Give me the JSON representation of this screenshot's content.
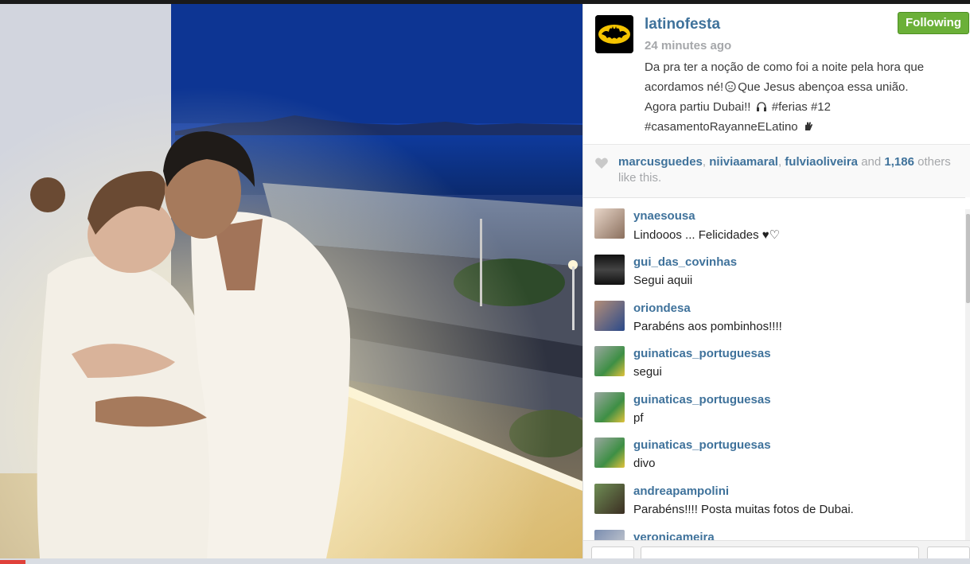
{
  "post": {
    "username": "latinofesta",
    "time_ago": "24 minutes ago",
    "follow_label": "Following",
    "caption_lines": [
      "Da pra ter a noção de como foi a noite pela hora que",
      "acordamos né!",
      "Que Jesus abençoa essa união.",
      "Agora partiu Dubai!!",
      "#ferias #12",
      "#casamentoRayanneELatino"
    ]
  },
  "likes": {
    "users": [
      "marcusguedes",
      "niiviaamaral",
      "fulviaoliveira"
    ],
    "and_text": "and",
    "count": "1,186",
    "suffix": "others like this."
  },
  "comments": [
    {
      "user": "ynaesousa",
      "text": "Lindooos ... Felicidades ♥♡"
    },
    {
      "user": "gui_das_covinhas",
      "text": "Segui aquii"
    },
    {
      "user": "oriondesa",
      "text": "Parabéns aos pombinhos!!!!"
    },
    {
      "user": "guinaticas_portuguesas",
      "text": "segui"
    },
    {
      "user": "guinaticas_portuguesas",
      "text": "pf"
    },
    {
      "user": "guinaticas_portuguesas",
      "text": "divo"
    },
    {
      "user": "andreapampolini",
      "text": "Parabéns!!!! Posta muitas fotos de Dubai."
    },
    {
      "user": "veronicameira",
      "text": ""
    }
  ],
  "colors": {
    "username": "#3f729b",
    "follow_button": "#6bb038",
    "muted": "#a5a7aa"
  },
  "icons": {
    "heart": "heart-icon",
    "user_avatar": "batman-logo-avatar"
  }
}
